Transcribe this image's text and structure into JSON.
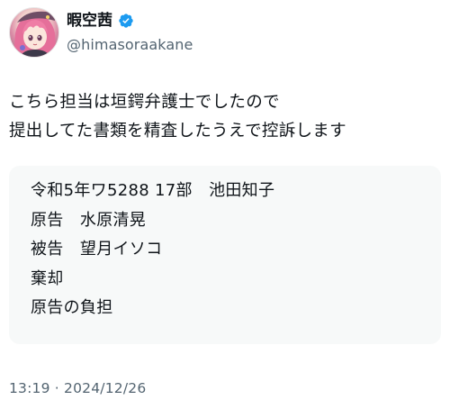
{
  "user": {
    "display_name": "暇空茜",
    "handle": "@himasoraakane",
    "verified": true,
    "verified_color": "#1d9bf0",
    "avatar_icon": "avatar-anime-character"
  },
  "tweet": {
    "lines": [
      "こちら担当は垣鍔弁護士でしたので",
      "提出してた書類を精査したうえで控訴します"
    ]
  },
  "card": {
    "lines": [
      "令和5年ワ5288 17部　池田知子",
      "原告　水原清晃",
      "被告　望月イソコ",
      "棄却",
      "原告の負担"
    ]
  },
  "timestamp": "13:19 · 2024/12/26"
}
